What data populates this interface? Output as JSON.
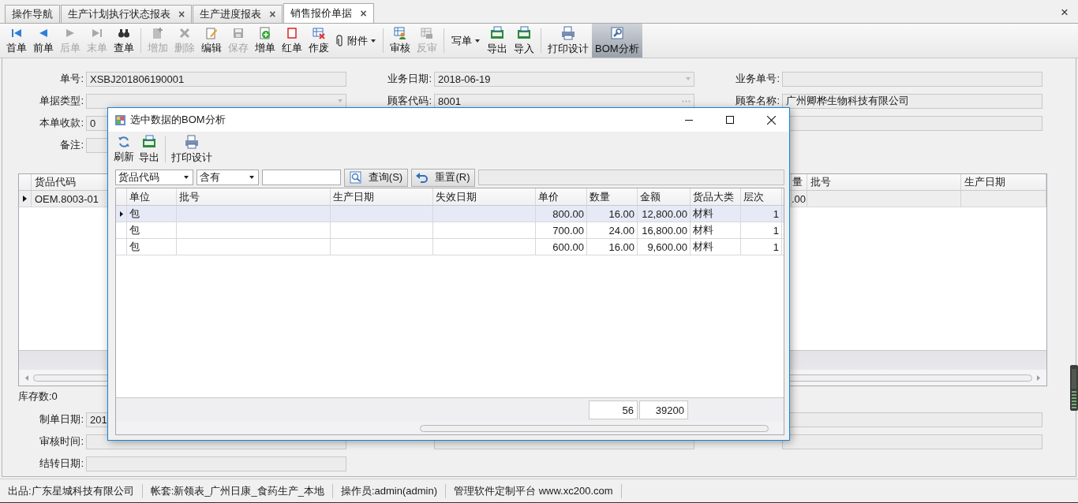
{
  "tabs": [
    {
      "label": "操作导航",
      "selected": false
    },
    {
      "label": "生产计划执行状态报表",
      "close": "×",
      "selected": false
    },
    {
      "label": "生产进度报表",
      "close": "×",
      "selected": false
    },
    {
      "label": "销售报价单据",
      "close": "×",
      "selected": true
    }
  ],
  "close_all": "×",
  "toolbar": {
    "groups": [
      [
        {
          "label": "首单",
          "kind": "button",
          "disabled": false,
          "pressed": false
        },
        {
          "label": "前单",
          "kind": "button",
          "disabled": false,
          "pressed": false
        },
        {
          "label": "后单",
          "kind": "button",
          "disabled": true,
          "pressed": false
        },
        {
          "label": "末单",
          "kind": "button",
          "disabled": true,
          "pressed": false
        },
        {
          "label": "查单",
          "kind": "button",
          "disabled": false,
          "pressed": false
        }
      ],
      [
        {
          "label": "增加",
          "kind": "button",
          "disabled": true,
          "pressed": false
        },
        {
          "label": "删除",
          "kind": "button",
          "disabled": true,
          "pressed": false
        },
        {
          "label": "编辑",
          "kind": "button",
          "disabled": false,
          "pressed": false
        },
        {
          "label": "保存",
          "kind": "button",
          "disabled": true,
          "pressed": false
        },
        {
          "label": "增单",
          "kind": "button",
          "disabled": false,
          "pressed": false
        },
        {
          "label": "红单",
          "kind": "button",
          "disabled": false,
          "pressed": false
        },
        {
          "label": "作废",
          "kind": "button",
          "disabled": false,
          "pressed": false
        },
        {
          "label": "附件",
          "kind": "menu",
          "disabled": false,
          "pressed": false
        }
      ],
      [
        {
          "label": "审核",
          "kind": "button",
          "disabled": false,
          "pressed": false
        },
        {
          "label": "反审",
          "kind": "button",
          "disabled": true,
          "pressed": false
        }
      ],
      [
        {
          "label": "写单",
          "kind": "menu",
          "disabled": false,
          "pressed": false
        },
        {
          "label": "导出",
          "kind": "button",
          "disabled": false,
          "pressed": false
        },
        {
          "label": "导入",
          "kind": "button",
          "disabled": false,
          "pressed": false
        }
      ],
      [
        {
          "label": "打印设计",
          "kind": "button",
          "disabled": false,
          "pressed": false
        },
        {
          "label": "BOM分析",
          "kind": "button",
          "disabled": false,
          "pressed": true
        }
      ]
    ]
  },
  "form_top": [
    [
      {
        "kind": "text",
        "label": "单号:",
        "value": "XSBJ201806190001"
      },
      {
        "kind": "dropdown",
        "label": "业务日期:",
        "value": "2018-06-19"
      },
      {
        "kind": "text",
        "label": "业务单号:"
      }
    ],
    [
      {
        "kind": "dropdown",
        "label": "单据类型:"
      },
      {
        "kind": "lookup",
        "label": "顾客代码:",
        "value": "8001"
      },
      {
        "kind": "text",
        "label": "顾客名称:",
        "value": "广州卿桦生物科技有限公司"
      }
    ],
    [
      {
        "kind": "text",
        "label": "本单收款:",
        "value": "0"
      },
      {
        "kind": "covered"
      },
      {
        "kind": "text"
      }
    ],
    [
      {
        "kind": "text",
        "label": "备注:"
      },
      {
        "kind": "covered"
      },
      {
        "kind": "covered"
      }
    ]
  ],
  "main_grid": {
    "columns": [
      "货品代码",
      "量",
      "批号",
      "生产日期"
    ],
    "rows": [
      {
        "selected": true,
        "cells": [
          "OEM.8003-01",
          ".00",
          "",
          ""
        ]
      }
    ]
  },
  "stock_count": "库存数:0",
  "form_bottom": [
    [
      {
        "kind": "text",
        "label": "制单日期:",
        "value": "201"
      },
      {
        "kind": "covered"
      },
      {
        "kind": "text"
      }
    ],
    [
      {
        "kind": "text",
        "label": "审核时间:"
      },
      {
        "kind": "text"
      },
      {
        "kind": "text"
      }
    ],
    [
      {
        "kind": "text",
        "label": "结转日期:"
      },
      {
        "kind": "covered"
      },
      {
        "kind": "covered"
      }
    ]
  ],
  "status_bar": [
    "出品:广东星城科技有限公司",
    "帐套:新领表_广州日康_食药生产_本地",
    "操作员:admin(admin)",
    "管理软件定制平台 www.xc200.com"
  ],
  "dialog": {
    "title": "选中数据的BOM分析",
    "toolbar": [
      {
        "label": "刷新"
      },
      {
        "label": "导出"
      },
      {
        "label": "打印设计"
      }
    ],
    "filter": {
      "field": "货品代码",
      "operator": "含有",
      "query_button": "查询(S)",
      "reset_button": "重置(R)"
    },
    "columns": [
      "单位",
      "批号",
      "生产日期",
      "失效日期",
      "单价",
      "数量",
      "金额",
      "货品大类",
      "层次"
    ],
    "rows": [
      {
        "selected": true,
        "cells": [
          "包",
          "",
          "",
          "",
          "800.00",
          "16.00",
          "12,800.00",
          "材料",
          "1"
        ]
      },
      {
        "selected": false,
        "cells": [
          "包",
          "",
          "",
          "",
          "700.00",
          "24.00",
          "16,800.00",
          "材料",
          "1"
        ]
      },
      {
        "selected": false,
        "cells": [
          "包",
          "",
          "",
          "",
          "600.00",
          "16.00",
          "9,600.00",
          "材料",
          "1"
        ]
      }
    ],
    "totals": [
      "56",
      "39200"
    ]
  }
}
